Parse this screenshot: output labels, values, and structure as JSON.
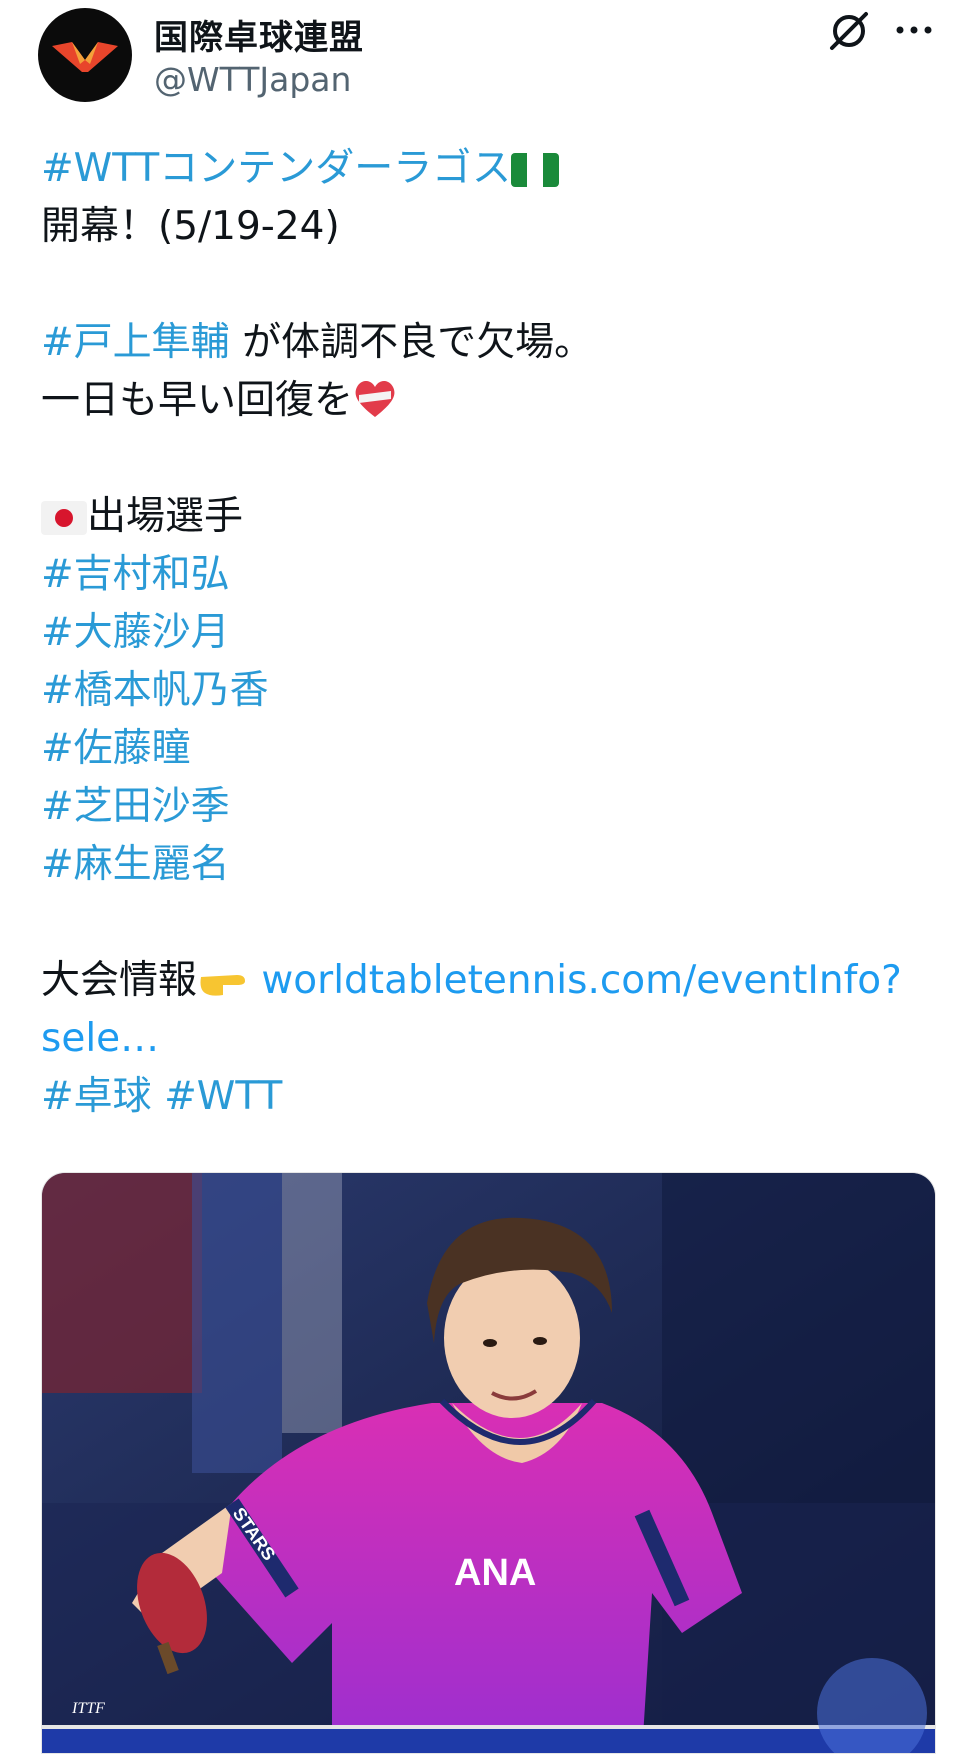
{
  "header": {
    "display_name": "国際卓球連盟",
    "handle": "@WTTJapan",
    "avatar_icon": "wtt-logo-icon",
    "grok_icon": "grok-icon",
    "more_icon": "more-dots-icon"
  },
  "tweet": {
    "line1_tag": "#WTTコンテンダーラゴス",
    "line1_emoji": "nigeria-flag-icon",
    "line2": "開幕！(5/19-24)",
    "line3_tag": "#戸上隼輔",
    "line3_text": " が体調不良で欠場。",
    "line4_text": "一日も早い回復を",
    "line4_emoji": "mending-heart-icon",
    "line5_emoji": "japan-flag-icon",
    "line5_text": "出場選手",
    "players": [
      "#吉村和弘",
      "#大藤沙月",
      "#橋本帆乃香",
      "#佐藤瞳",
      "#芝田沙季",
      "#麻生麗名"
    ],
    "info_label": "大会情報",
    "info_emoji": "pointing-hand-icon",
    "link_part1": " worldtabletennis.com/eventInfo?",
    "link_part2": "sele…",
    "footer_tag1": "#卓球",
    "footer_tag2": " #WTT"
  },
  "media": {
    "alt_icon": "photo-table-tennis-player",
    "shirt_text": "ANA",
    "sleeve_text": "STARS",
    "logo_text": "ITTF"
  },
  "colors": {
    "hashtag": "#2a9ad6",
    "text": "#0f1419",
    "handle": "#536471",
    "shirt": "#d92fb4"
  }
}
